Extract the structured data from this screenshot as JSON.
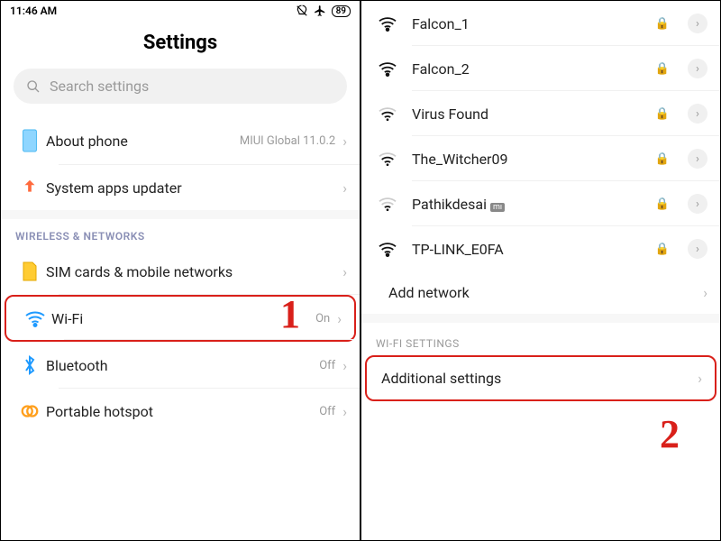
{
  "status_bar": {
    "time": "11:46 AM",
    "battery": "89"
  },
  "left": {
    "title": "Settings",
    "search_placeholder": "Search settings",
    "items": [
      {
        "label": "About phone",
        "value": "MIUI Global 11.0.2"
      },
      {
        "label": "System apps updater",
        "value": ""
      }
    ],
    "section_header": "WIRELESS & NETWORKS",
    "wireless": [
      {
        "label": "SIM cards & mobile networks",
        "value": ""
      },
      {
        "label": "Wi-Fi",
        "value": "On"
      },
      {
        "label": "Bluetooth",
        "value": "Off"
      },
      {
        "label": "Portable hotspot",
        "value": "Off"
      }
    ]
  },
  "right": {
    "networks": [
      {
        "name": "Falcon_1",
        "signal": 4,
        "locked": true
      },
      {
        "name": "Falcon_2",
        "signal": 4,
        "locked": true
      },
      {
        "name": "Virus Found",
        "signal": 3,
        "locked": true
      },
      {
        "name": "The_Witcher09",
        "signal": 3,
        "locked": true
      },
      {
        "name": "Pathikdesai",
        "signal": 2,
        "locked": true,
        "mi": true
      },
      {
        "name": "TP-LINK_E0FA",
        "signal": 4,
        "locked": true
      }
    ],
    "add_network": "Add network",
    "section_header": "WI-FI SETTINGS",
    "additional": "Additional settings"
  },
  "annotations": {
    "one": "1",
    "two": "2"
  }
}
